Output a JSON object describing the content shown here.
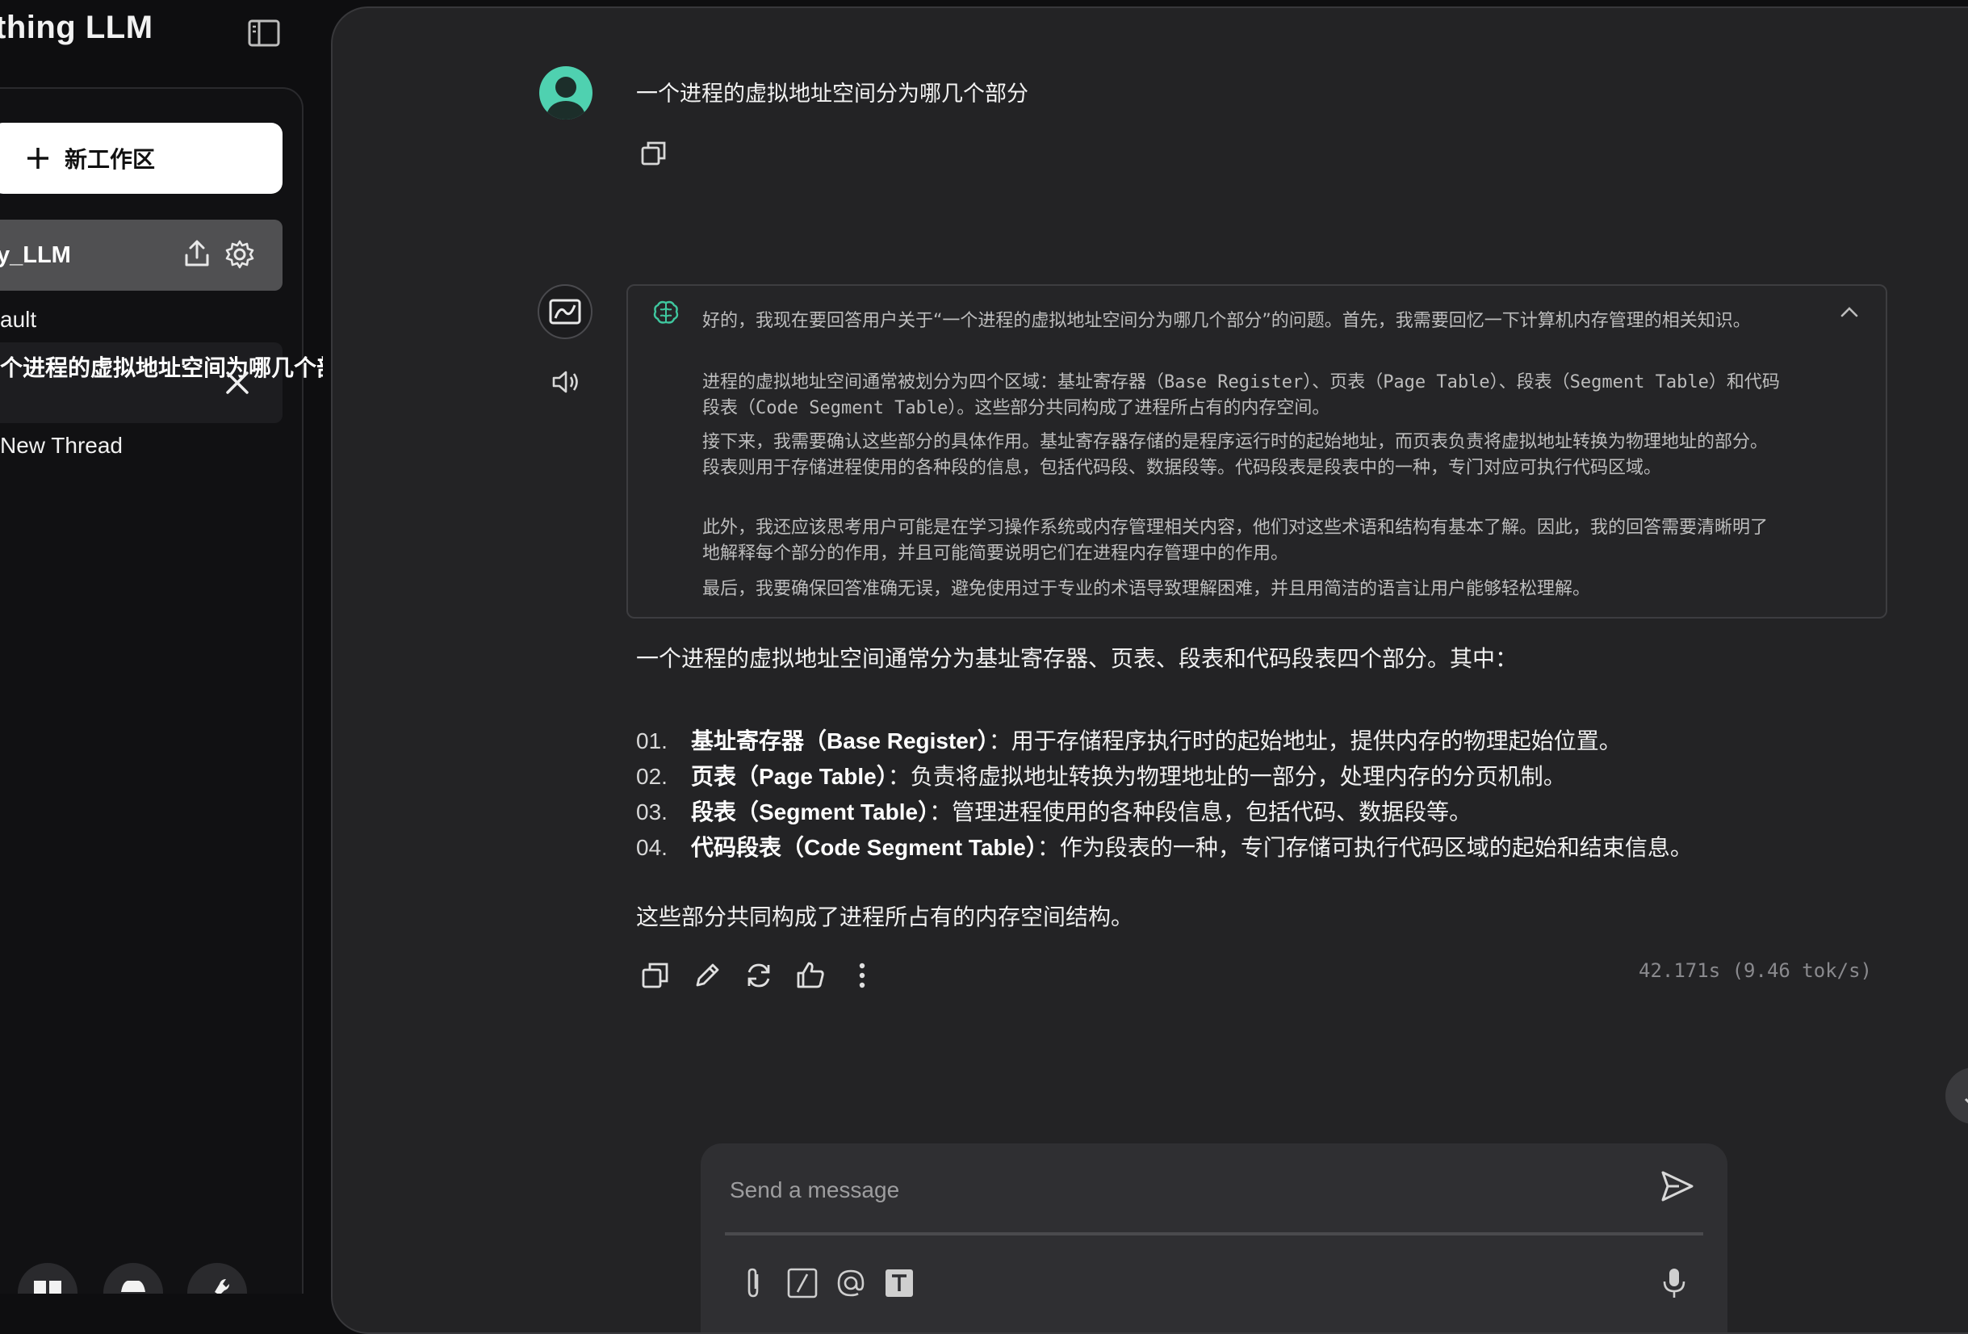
{
  "sidebar": {
    "brand": "thing LLM",
    "new_workspace_label": "新工作区",
    "workspace_name": "y_LLM",
    "threads": {
      "default": "ault",
      "active_title": "个进程的虚拟地址空间为哪几个部分",
      "new_thread": "New Thread"
    }
  },
  "chat": {
    "user_message": "一个进程的虚拟地址空间分为哪几个部分",
    "thinking": [
      "好的，我现在要回答用户关于“一个进程的虚拟地址空间分为哪几个部分”的问题。首先，我需要回忆一下计算机内存管理的相关知识。",
      "进程的虚拟地址空间通常被划分为四个区域：基址寄存器（Base Register）、页表（Page Table）、段表（Segment Table）和代码段表（Code Segment Table）。这些部分共同构成了进程所占有的内存空间。",
      "接下来，我需要确认这些部分的具体作用。基址寄存器存储的是程序运行时的起始地址，而页表负责将虚拟地址转换为物理地址的部分。段表则用于存储进程使用的各种段的信息，包括代码段、数据段等。代码段表是段表中的一种，专门对应可执行代码区域。",
      "此外，我还应该思考用户可能是在学习操作系统或内存管理相关内容，他们对这些术语和结构有基本了解。因此，我的回答需要清晰明了地解释每个部分的作用，并且可能简要说明它们在进程内存管理中的作用。",
      "最后，我要确保回答准确无误，避免使用过于专业的术语导致理解困难，并且用简洁的语言让用户能够轻松理解。"
    ],
    "answer_intro": "一个进程的虚拟地址空间通常分为基址寄存器、页表、段表和代码段表四个部分。其中：",
    "answer_items": [
      {
        "num": "01.",
        "term": "基址寄存器（Base Register）",
        "desc": "：用于存储程序执行时的起始地址，提供内存的物理起始位置。"
      },
      {
        "num": "02.",
        "term": "页表（Page Table）",
        "desc": "：负责将虚拟地址转换为物理地址的一部分，处理内存的分页机制。"
      },
      {
        "num": "03.",
        "term": "段表（Segment Table）",
        "desc": "：管理进程使用的各种段信息，包括代码、数据段等。"
      },
      {
        "num": "04.",
        "term": "代码段表（Code Segment Table）",
        "desc": "：作为段表的一种，专门存储可执行代码区域的起始和结束信息。"
      }
    ],
    "answer_outro": "这些部分共同构成了进程所占有的内存空间结构。",
    "metrics": "42.171s (9.46 tok/s)"
  },
  "composer": {
    "placeholder": "Send a message"
  },
  "colors": {
    "avatar_accent": "#4fd1b0",
    "brain_icon": "#3fc79f"
  }
}
